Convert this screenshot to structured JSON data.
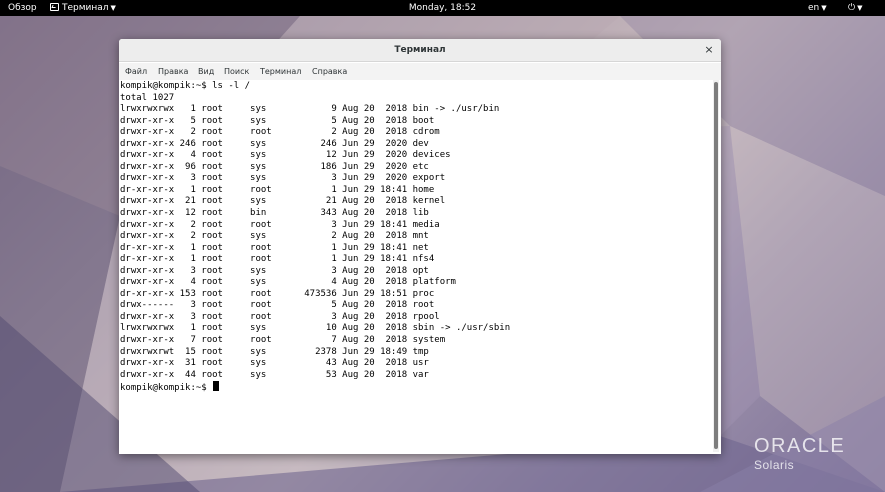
{
  "topbar": {
    "overview": "Обзор",
    "app_name": "Терминал",
    "clock": "Monday, 18:52",
    "language": "en"
  },
  "window": {
    "title": "Терминал",
    "close_symbol": "×"
  },
  "menubar": {
    "items": [
      "Файл",
      "Правка",
      "Вид",
      "Поиск",
      "Терминал",
      "Справка"
    ]
  },
  "terminal": {
    "lines": [
      "kompik@kompik:~$ ls -l /",
      "total 1027",
      "lrwxrwxrwx   1 root     sys            9 Aug 20  2018 bin -> ./usr/bin",
      "drwxr-xr-x   5 root     sys            5 Aug 20  2018 boot",
      "drwxr-xr-x   2 root     root           2 Aug 20  2018 cdrom",
      "drwxr-xr-x 246 root     sys          246 Jun 29  2020 dev",
      "drwxr-xr-x   4 root     sys           12 Jun 29  2020 devices",
      "drwxr-xr-x  96 root     sys          186 Jun 29  2020 etc",
      "drwxr-xr-x   3 root     sys            3 Jun 29  2020 export",
      "dr-xr-xr-x   1 root     root           1 Jun 29 18:41 home",
      "drwxr-xr-x  21 root     sys           21 Aug 20  2018 kernel",
      "drwxr-xr-x  12 root     bin          343 Aug 20  2018 lib",
      "drwxr-xr-x   2 root     root           3 Jun 29 18:41 media",
      "drwxr-xr-x   2 root     sys            2 Aug 20  2018 mnt",
      "dr-xr-xr-x   1 root     root           1 Jun 29 18:41 net",
      "dr-xr-xr-x   1 root     root           1 Jun 29 18:41 nfs4",
      "drwxr-xr-x   3 root     sys            3 Aug 20  2018 opt",
      "drwxr-xr-x   4 root     sys            4 Aug 20  2018 platform",
      "dr-xr-xr-x 153 root     root      473536 Jun 29 18:51 proc",
      "drwx------   3 root     root           5 Aug 20  2018 root",
      "drwxr-xr-x   3 root     root           3 Aug 20  2018 rpool",
      "lrwxrwxrwx   1 root     sys           10 Aug 20  2018 sbin -> ./usr/sbin",
      "drwxr-xr-x   7 root     root           7 Aug 20  2018 system",
      "drwxrwxrwt  15 root     sys         2378 Jun 29 18:49 tmp",
      "drwxr-xr-x  31 root     sys           43 Aug 20  2018 usr",
      "drwxr-xr-x  44 root     sys           53 Aug 20  2018 var"
    ],
    "prompt": "kompik@kompik:~$ "
  },
  "logo": {
    "top": "ORACLE",
    "bottom": "Solaris"
  },
  "colors": {
    "topbar": "#000000",
    "terminal_bg": "#ffffff",
    "terminal_fg": "#000000"
  }
}
